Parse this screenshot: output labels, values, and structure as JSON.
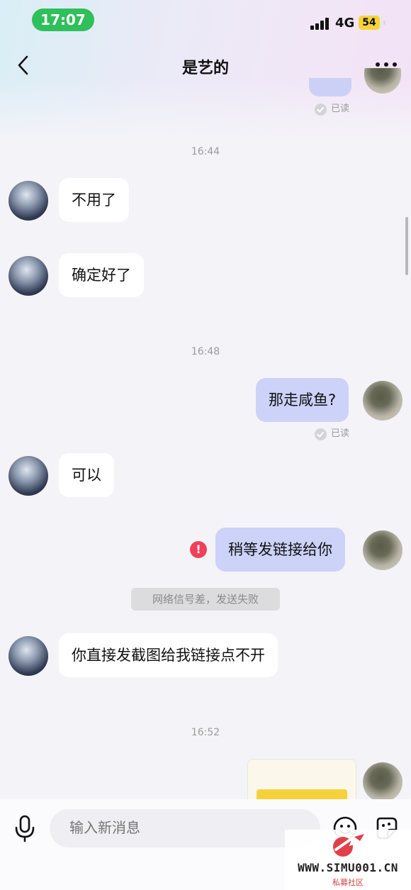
{
  "status_bar": {
    "time": "17:07",
    "network": "4G",
    "battery": "54"
  },
  "header": {
    "title": "是艺的"
  },
  "messages": {
    "read_receipt": "已读",
    "ts1": "16:44",
    "m1": "不用了",
    "m2": "确定好了",
    "ts2": "16:48",
    "m3": "那走咸鱼?",
    "m4": "可以",
    "m5": "稍等发链接给你",
    "m5_error": "!",
    "system_notice": "网络信号差，发送失败",
    "m6": "你直接发截图给我链接点不开",
    "ts3": "16:52"
  },
  "input": {
    "placeholder": "输入新消息"
  },
  "watermark": {
    "site": "WWW.SIMU001.CN",
    "sub": "私募社区"
  },
  "colors": {
    "outgoing_bubble": "#ccd2f8",
    "incoming_bubble": "#ffffff",
    "time_pill": "#2fbf5b",
    "error": "#f0405a"
  },
  "icons": [
    "back-icon",
    "more-icon",
    "mic-icon",
    "emoji-icon",
    "sticker-icon",
    "error-icon",
    "read-check-icon"
  ]
}
